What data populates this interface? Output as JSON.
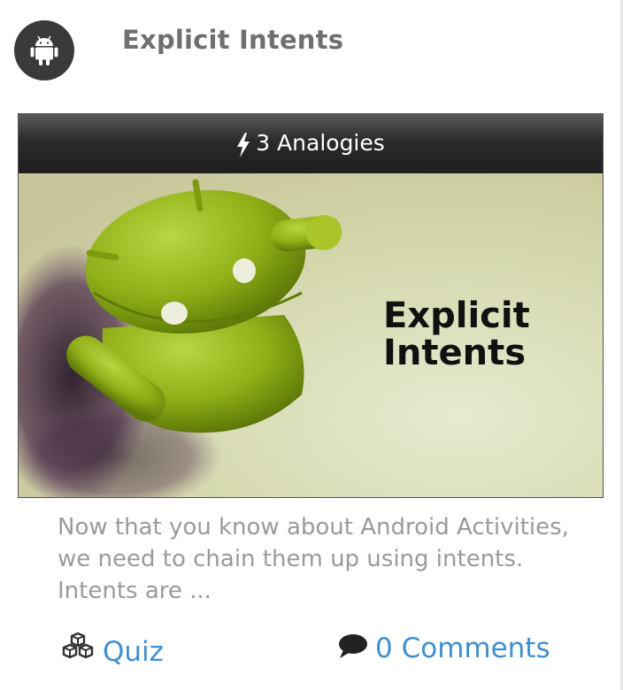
{
  "post": {
    "title": "Explicit Intents",
    "avatar_icon": "android-icon",
    "analogies_label": "3 Analogies",
    "analogies_icon": "bolt-icon",
    "thumbnail_text_line1": "Explicit",
    "thumbnail_text_line2": "Intents",
    "excerpt": "Now that you know about Android Activities, we need to chain them up using intents. Intents are ..."
  },
  "footer": {
    "quiz_label": "Quiz",
    "quiz_icon": "cubes-icon",
    "comments_label": "0 Comments",
    "comments_icon": "comment-icon"
  },
  "colors": {
    "link": "#3f8fcf",
    "title": "#6f6f6f",
    "excerpt": "#9a9a9a",
    "android_green": "#9dbb1e"
  }
}
